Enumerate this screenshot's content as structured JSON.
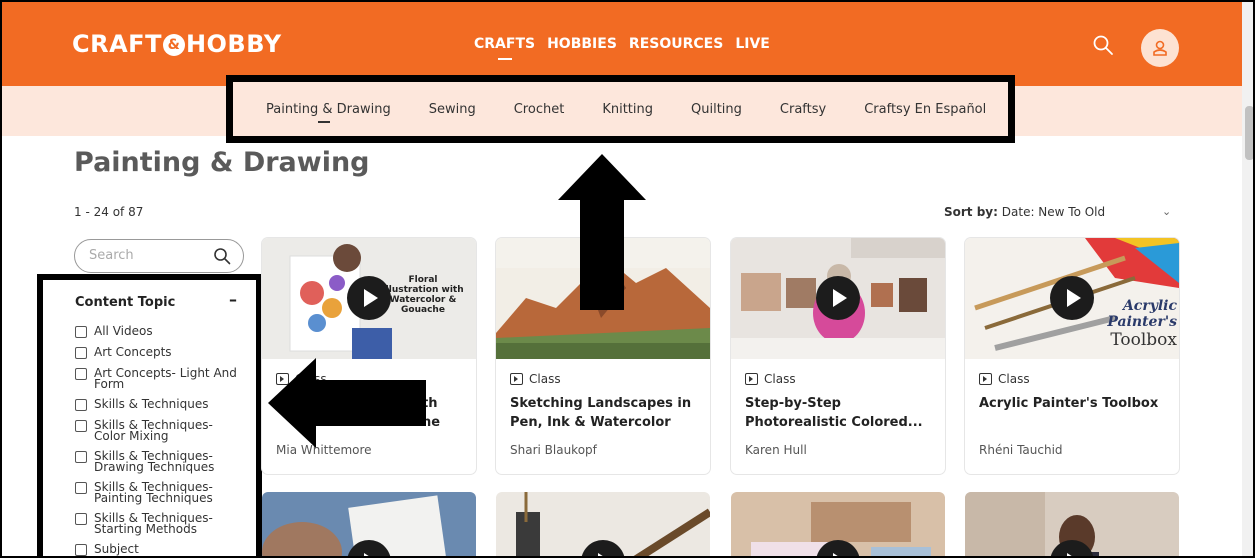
{
  "header": {
    "logo_left": "CRAFT",
    "logo_amp": "&",
    "logo_right": "HOBBY",
    "nav": [
      {
        "label": "CRAFTS"
      },
      {
        "label": "HOBBIES"
      },
      {
        "label": "RESOURCES"
      },
      {
        "label": "LIVE"
      }
    ],
    "brand_color": "#f26b23"
  },
  "subnav": {
    "items": [
      {
        "label": "Painting & Drawing"
      },
      {
        "label": "Sewing"
      },
      {
        "label": "Crochet"
      },
      {
        "label": "Knitting"
      },
      {
        "label": "Quilting"
      },
      {
        "label": "Craftsy"
      },
      {
        "label": "Craftsy En Español"
      }
    ]
  },
  "page": {
    "title": "Painting & Drawing",
    "count_range": "1 - 24",
    "count_of": " of 87",
    "sort_label": "Sort by:",
    "sort_value": "Date: New To Old"
  },
  "sidebar": {
    "search_placeholder": "Search",
    "filter_title": "Content Topic",
    "filter_collapse": "–",
    "filters": [
      {
        "label": "All Videos"
      },
      {
        "label": "Art Concepts"
      },
      {
        "label": "Art Concepts- Light And Form"
      },
      {
        "label": "Skills & Techniques"
      },
      {
        "label": "Skills & Techniques- Color Mixing"
      },
      {
        "label": "Skills & Techniques- Drawing Techniques"
      },
      {
        "label": "Skills & Techniques- Painting Techniques"
      },
      {
        "label": "Skills & Techniques- Starting Methods"
      },
      {
        "label": "Subject"
      }
    ]
  },
  "cards": [
    {
      "type": "Class",
      "title": "Floral Illustration With Watercolor & Gouache",
      "title_visible": "th",
      "title_visible2": "he",
      "author": "Mia Whittemore",
      "thumb_text": "Floral Illustration with Watercolor & Gouache"
    },
    {
      "type": "Class",
      "title": "Sketching Landscapes in Pen, Ink & Watercolor",
      "author": "Shari Blaukopf"
    },
    {
      "type": "Class",
      "title": "Step-by-Step Photorealistic Colored...",
      "author": "Karen Hull"
    },
    {
      "type": "Class",
      "title": "Acrylic Painter's Toolbox",
      "author": "Rhéni Tauchid",
      "thumb_text1": "Acrylic Painter's",
      "thumb_text2": "Toolbox"
    }
  ]
}
